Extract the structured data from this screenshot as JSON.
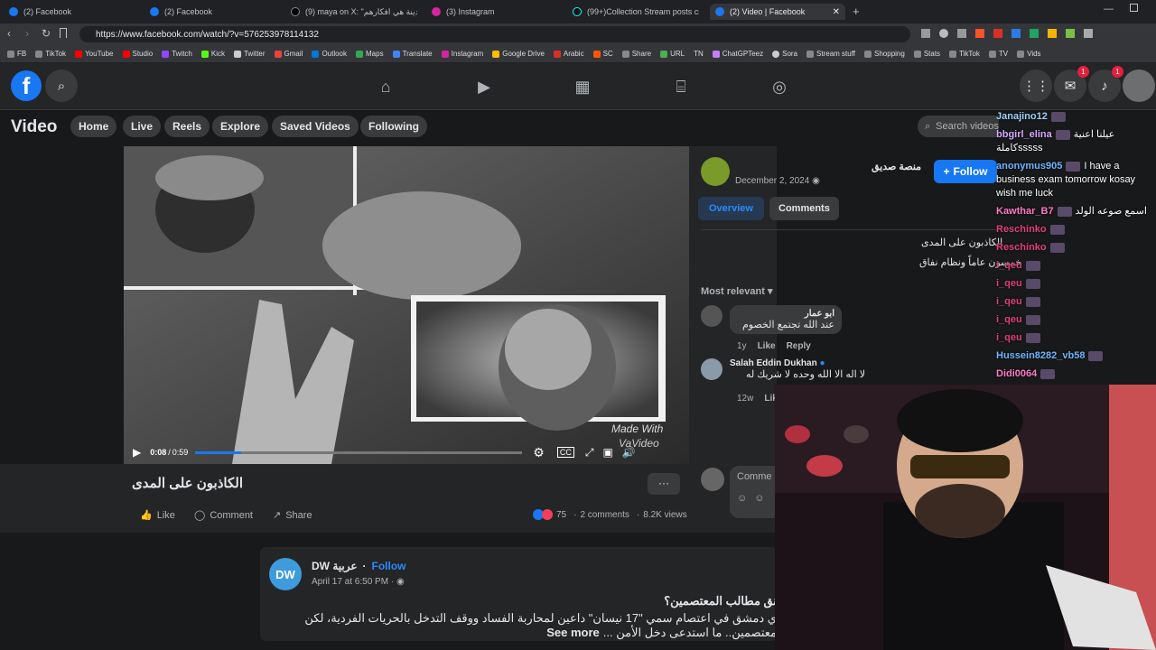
{
  "tabs": [
    {
      "label": "(2) Facebook"
    },
    {
      "label": "(2) Facebook"
    },
    {
      "label": "(9) maya on X: \"بن المدينة هي افكارهم"
    },
    {
      "label": "(3) Instagram"
    },
    {
      "label": "(99+)Collection Stream posts created"
    },
    {
      "label": "(2) Video | Facebook"
    }
  ],
  "url": "https://www.facebook.com/watch/?v=576253978114132",
  "bookmarks": [
    "FB",
    "TikTok",
    "YouTube",
    "Studio",
    "Twitch",
    "Kick",
    "Twitter",
    "Gmail",
    "Outlook",
    "Maps",
    "Translate",
    "Instagram",
    "Google Drive",
    "Arabic",
    "SC",
    "Share",
    "URL",
    "TN",
    "ChatGPTeez",
    "Sora",
    "Stream stuff",
    "Shopping",
    "Stats",
    "TikTok",
    "TV",
    "Vids"
  ],
  "fb": {
    "logo": "f",
    "nav_badge_messenger": "1",
    "nav_badge_notifications": "1"
  },
  "subnav": {
    "title": "Video",
    "items": [
      "Home",
      "Live",
      "Reels",
      "Explore",
      "Saved Videos",
      "Following"
    ],
    "search_placeholder": "Search videos"
  },
  "video": {
    "time_current": "0:08",
    "time_total": "0:59",
    "progress": 0.14,
    "watermark": "Made With",
    "watermark2": "VaVideo"
  },
  "post": {
    "title": "الكاذبون على المدى",
    "like": "Like",
    "comment": "Comment",
    "share": "Share",
    "reactions": "75",
    "comments": "2 comments",
    "views": "8.2K views",
    "more": "···"
  },
  "side": {
    "page_name": "منصة صديق",
    "follow": "Follow",
    "date": "December 2, 2024",
    "tab_overview": "Overview",
    "tab_comments": "Comments",
    "desc_line1": "الكاذبون على المدى",
    "desc_line2": "خمسون عاماً ونظام نفاق",
    "sort": "Most relevant",
    "c1_author": "ابو عمار",
    "c1_text": "عند الله تجتمع الخصوم",
    "c1_age": "1y",
    "c1_like": "Like",
    "c1_reply": "Reply",
    "c2_author": "Salah Eddin Dukhan",
    "c2_text": "لا اله الا الله وحده لا شريك له",
    "c2_age": "12w",
    "c2_like": "Lik",
    "comment_placeholder": "Comme"
  },
  "feed2": {
    "page": "DW عربية",
    "follow": "Follow",
    "date": "April 17 at 6:50 PM",
    "line1": "نق مطالب المعتصمين؟",
    "line2": "ي دمشق في اعتصام سمي \"17 نيسان\" داعين لمحاربة الفساد ووقف التدخل بالحريات الفردية، لكن",
    "line3": "معتصمين.. ما استدعى دخل الأمن ...",
    "see_more": "See more"
  },
  "chat": [
    {
      "user": "Janajino12",
      "msg": "",
      "color": "#9ad3ff"
    },
    {
      "user": "bbgirl_elina",
      "msg": "عيلنا اعنية كاملةsssss",
      "color": "#d6a5ff"
    },
    {
      "user": "anonymus905",
      "msg": "I have a business exam tomorrow kosay wish me luck",
      "color": "#6fb4ff"
    },
    {
      "user": "Kawthar_B7",
      "msg": "اسمع صوعه الولد",
      "color": "#ff7ac6"
    },
    {
      "user": "Reschinko",
      "msg": "",
      "color": "#e0407a"
    },
    {
      "user": "Reschinko",
      "msg": "",
      "color": "#e0407a"
    },
    {
      "user": "i_qeu",
      "msg": "",
      "color": "#e0407a"
    },
    {
      "user": "i_qeu",
      "msg": "",
      "color": "#e0407a"
    },
    {
      "user": "i_qeu",
      "msg": "",
      "color": "#e0407a"
    },
    {
      "user": "i_qeu",
      "msg": "",
      "color": "#e0407a"
    },
    {
      "user": "i_qeu",
      "msg": "",
      "color": "#e0407a"
    },
    {
      "user": "Hussein8282_vb58",
      "msg": "",
      "color": "#6fb4ff"
    },
    {
      "user": "Didi0064",
      "msg": "",
      "color": "#ff7ac6"
    }
  ],
  "colors": {
    "accent": "#1877f2",
    "bg": "#18191a",
    "panel": "#242526"
  }
}
